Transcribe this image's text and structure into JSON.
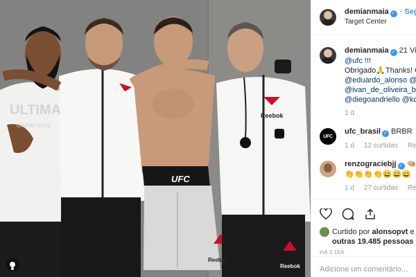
{
  "post": {
    "username": "demianmaia",
    "follow_label": "Segu",
    "location": "Target Center"
  },
  "photo": {
    "shirt_text_left": "ULTIMA",
    "shirt_text_left2": "CHAMPIONS",
    "shorts_logo": "UFC",
    "sponsor": "Reebok"
  },
  "comments": [
    {
      "username": "demianmaia",
      "text": "21 Vit",
      "lines": [
        "@ufc !!!",
        "Obrigado🙏Thanks! C",
        "@eduardo_alonso @v",
        "@ivan_de_oliveira_bo",
        "@diegoandriello @ko"
      ],
      "age": "1 d"
    },
    {
      "username": "ufc_brasil",
      "text": "BRBR",
      "likes": "12 curtidas",
      "reply": "Respo",
      "age": "1 d"
    },
    {
      "username": "renzograciebjj",
      "text": "🤜🏼",
      "emoji_line": "👏👏👏👏😄😄😄",
      "likes": "27 curtidas",
      "reply": "Respo",
      "age": "1 d"
    }
  ],
  "likes": {
    "prefix": "Curtido por",
    "user": "alonsopvt",
    "joiner": "e",
    "others": "outras 19.485 pessoas"
  },
  "timestamp": "HÁ 1 DIA",
  "add_comment_placeholder": "Adicione um comentário..."
}
